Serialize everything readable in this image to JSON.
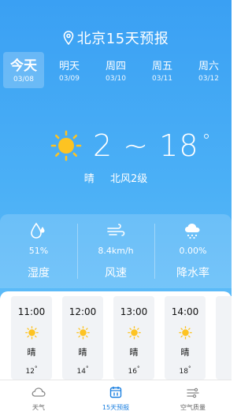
{
  "header": {
    "title": "北京15天预报",
    "icon": "location-pin-icon"
  },
  "days": [
    {
      "name": "今天",
      "date": "03/08",
      "active": true
    },
    {
      "name": "明天",
      "date": "03/09"
    },
    {
      "name": "周四",
      "date": "03/10"
    },
    {
      "name": "周五",
      "date": "03/11"
    },
    {
      "name": "周六",
      "date": "03/12"
    }
  ],
  "current": {
    "icon": "sun-icon",
    "temp_range": "2 ~ 18",
    "degree": "°",
    "condition": "晴",
    "wind": "北风2级"
  },
  "metrics": [
    {
      "icon": "humidity-drop-icon",
      "value": "51%",
      "label": "湿度"
    },
    {
      "icon": "wind-icon",
      "value": "8.4km/h",
      "label": "风速"
    },
    {
      "icon": "rain-cloud-icon",
      "value": "0.00%",
      "label": "降水率"
    }
  ],
  "hourly": [
    {
      "time": "11:00",
      "condition": "晴",
      "temp": "12",
      "unit": "°"
    },
    {
      "time": "12:00",
      "condition": "晴",
      "temp": "14",
      "unit": "°"
    },
    {
      "time": "13:00",
      "condition": "晴",
      "temp": "16",
      "unit": "°"
    },
    {
      "time": "14:00",
      "condition": "晴",
      "temp": "18",
      "unit": "°"
    }
  ],
  "tabbar": [
    {
      "label": "天气",
      "icon": "cloud-icon"
    },
    {
      "label": "15天预报",
      "icon": "calendar-icon",
      "active": true
    },
    {
      "label": "空气质量",
      "icon": "air-quality-icon"
    }
  ],
  "colors": {
    "accent": "#1a7fe0",
    "sun": "#fdc322",
    "sky_top": "#3aa0f3",
    "sky_bottom": "#6ec6fb"
  }
}
